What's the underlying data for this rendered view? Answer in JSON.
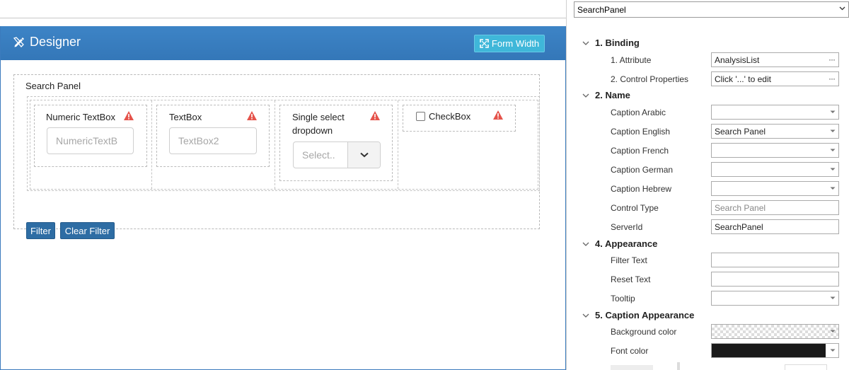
{
  "designer": {
    "title": "Designer",
    "form_width_label": "Form Width",
    "search_panel_title": "Search Panel",
    "fields": {
      "numeric": {
        "label": "Numeric TextBox",
        "placeholder": "NumericTextB"
      },
      "textbox": {
        "label": "TextBox",
        "placeholder": "TextBox2"
      },
      "dropdown": {
        "label_line1": "Single select",
        "label_line2": "dropdown",
        "placeholder": "Select.."
      },
      "checkbox": {
        "label": "CheckBox"
      }
    },
    "filter_label": "Filter",
    "clear_filter_label": "Clear Filter"
  },
  "properties": {
    "selected_object": "SearchPanel",
    "sections": {
      "binding": "1. Binding",
      "name": "2. Name",
      "appearance": "4. Appearance",
      "caption_appearance": "5. Caption Appearance"
    },
    "rows": {
      "attribute": {
        "label": "1. Attribute",
        "value": "AnalysisList"
      },
      "control_properties": {
        "label": "2. Control Properties",
        "value": "Click '...' to edit"
      },
      "caption_arabic": {
        "label": "Caption Arabic",
        "value": ""
      },
      "caption_english": {
        "label": "Caption English",
        "value": "Search Panel"
      },
      "caption_french": {
        "label": "Caption French",
        "value": ""
      },
      "caption_german": {
        "label": "Caption German",
        "value": ""
      },
      "caption_hebrew": {
        "label": "Caption Hebrew",
        "value": ""
      },
      "control_type": {
        "label": "Control Type",
        "value": "Search Panel"
      },
      "server_id": {
        "label": "ServerId",
        "value": "SearchPanel"
      },
      "filter_text": {
        "label": "Filter Text",
        "value": ""
      },
      "reset_text": {
        "label": "Reset Text",
        "value": ""
      },
      "tooltip": {
        "label": "Tooltip",
        "value": ""
      },
      "background_color": {
        "label": "Background color",
        "value": "transparent"
      },
      "font_color": {
        "label": "Font color",
        "value": "#1a1a1a"
      }
    }
  },
  "colors": {
    "header_blue": "#3a7fc1",
    "form_width_cyan": "#3fb7d9",
    "button_dark_blue": "#2e6da4",
    "warning_red": "#e5534b"
  }
}
